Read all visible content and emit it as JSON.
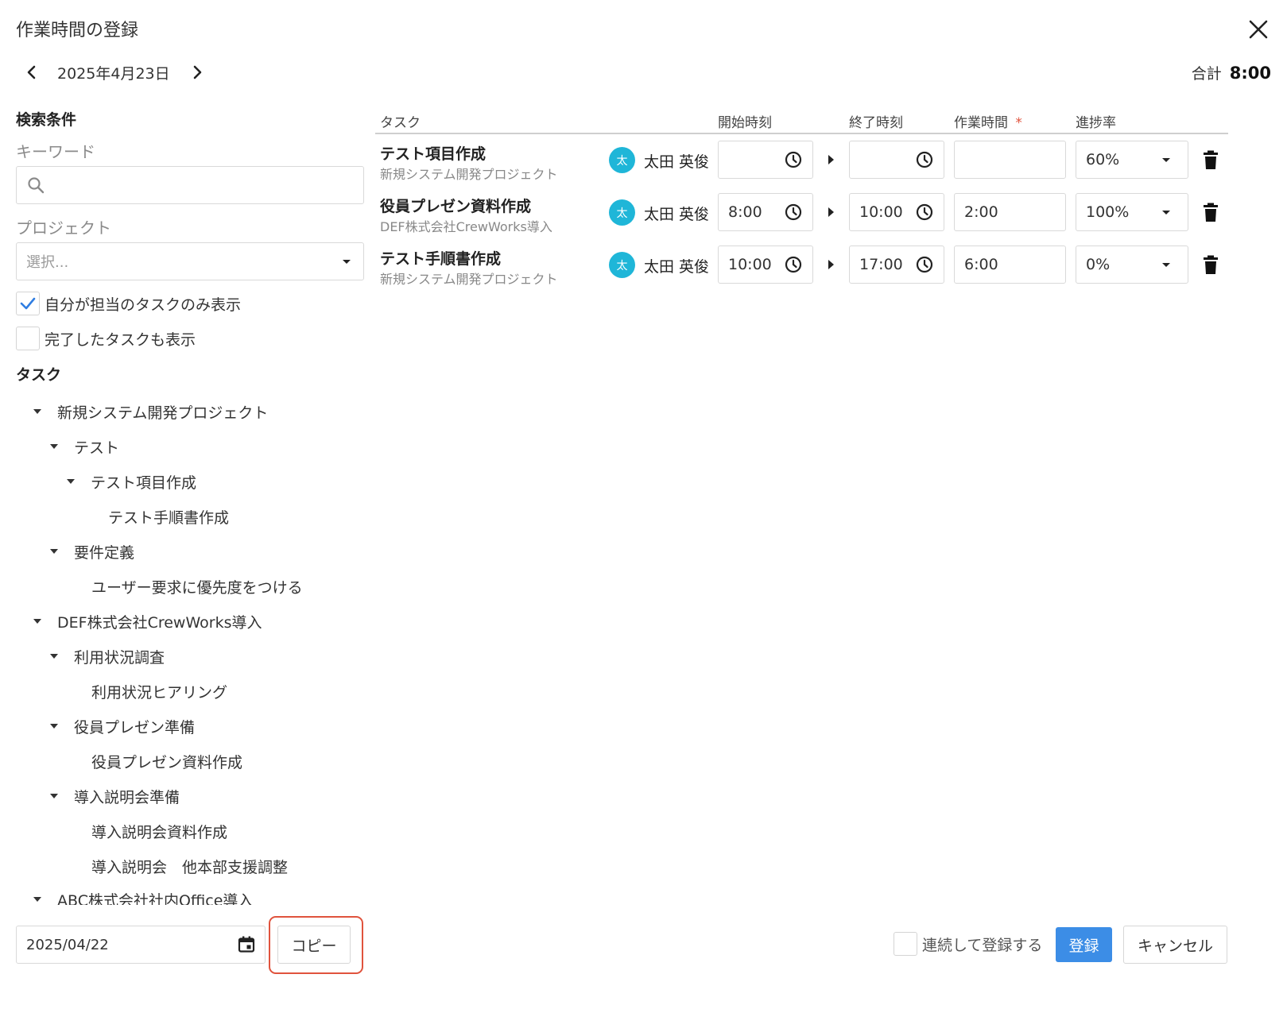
{
  "dialog": {
    "title": "作業時間の登録"
  },
  "date_nav": {
    "date": "2025年4月23日"
  },
  "total": {
    "label": "合計",
    "value": "8:00"
  },
  "search": {
    "heading": "検索条件",
    "keyword_label": "キーワード",
    "keyword_value": "",
    "project_label": "プロジェクト",
    "project_placeholder": "選択...",
    "only_mine": {
      "label": "自分が担当のタスクのみ表示",
      "checked": true
    },
    "show_completed": {
      "label": "完了したタスクも表示",
      "checked": false
    }
  },
  "tree": {
    "heading": "タスク",
    "items": [
      {
        "label": "新規システム開発プロジェクト",
        "level": 0,
        "expanded": true
      },
      {
        "label": "テスト",
        "level": 1,
        "expanded": true
      },
      {
        "label": "テスト項目作成",
        "level": 2,
        "expanded": true
      },
      {
        "label": "テスト手順書作成",
        "level": 3,
        "expanded": false
      },
      {
        "label": "要件定義",
        "level": 1,
        "expanded": true
      },
      {
        "label": "ユーザー要求に優先度をつける",
        "level": 2,
        "expanded": false
      },
      {
        "label": "DEF株式会社CrewWorks導入",
        "level": 0,
        "expanded": true
      },
      {
        "label": "利用状況調査",
        "level": 1,
        "expanded": true
      },
      {
        "label": "利用状況ヒアリング",
        "level": 2,
        "expanded": false
      },
      {
        "label": "役員プレゼン準備",
        "level": 1,
        "expanded": true
      },
      {
        "label": "役員プレゼン資料作成",
        "level": 2,
        "expanded": false
      },
      {
        "label": "導入説明会準備",
        "level": 1,
        "expanded": true
      },
      {
        "label": "導入説明会資料作成",
        "level": 2,
        "expanded": false
      },
      {
        "label": "導入説明会　他本部支援調整",
        "level": 2,
        "expanded": false
      },
      {
        "label": "ABC株式会社社内Office導入",
        "level": 0,
        "expanded": true
      }
    ]
  },
  "table": {
    "headers": {
      "task": "タスク",
      "start": "開始時刻",
      "end": "終了時刻",
      "duration": "作業時間",
      "required_mark": "*",
      "progress": "進捗率"
    },
    "rows": [
      {
        "task": "テスト項目作成",
        "project": "新規システム開発プロジェクト",
        "avatar": "太",
        "person": "太田 英俊",
        "start": "",
        "end": "",
        "duration": "",
        "progress": "60%"
      },
      {
        "task": "役員プレゼン資料作成",
        "project": "DEF株式会社CrewWorks導入",
        "avatar": "太",
        "person": "太田 英俊",
        "start": "8:00",
        "end": "10:00",
        "duration": "2:00",
        "progress": "100%"
      },
      {
        "task": "テスト手順書作成",
        "project": "新規システム開発プロジェクト",
        "avatar": "太",
        "person": "太田 英俊",
        "start": "10:00",
        "end": "17:00",
        "duration": "6:00",
        "progress": "0%"
      }
    ]
  },
  "footer": {
    "copy_date": "2025/04/22",
    "copy_label": "コピー",
    "continuous_label": "連続して登録する",
    "register_label": "登録",
    "cancel_label": "キャンセル"
  },
  "colors": {
    "primary": "#3c8de6",
    "avatar": "#1fb6d8",
    "highlight": "#e0533d",
    "required": "#e0533d",
    "check": "#2f7de1"
  }
}
